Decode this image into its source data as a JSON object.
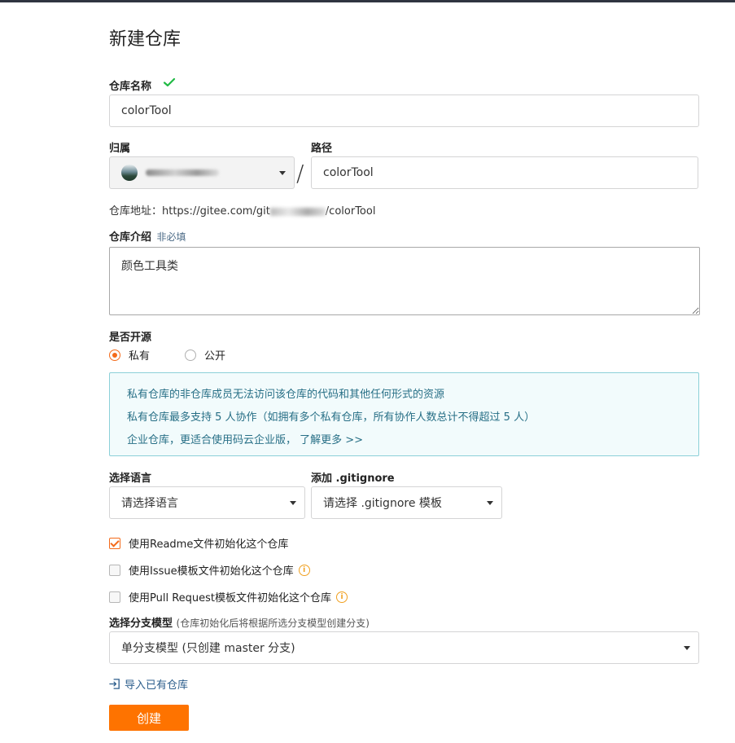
{
  "page": {
    "title": "新建仓库"
  },
  "repo_name": {
    "label": "仓库名称",
    "value": "colorTool"
  },
  "owner": {
    "label": "归属"
  },
  "path": {
    "label": "路径",
    "separator": "/",
    "value": "colorTool"
  },
  "address": {
    "prefix": "仓库地址：https://gitee.com/git",
    "suffix": "/colorTool"
  },
  "description": {
    "label": "仓库介绍",
    "optional_tag": "非必填",
    "value": "颜色工具类"
  },
  "visibility": {
    "label": "是否开源",
    "options": [
      {
        "label": "私有",
        "selected": true
      },
      {
        "label": "公开",
        "selected": false
      }
    ]
  },
  "notice": {
    "lines": [
      "私有仓库的非仓库成员无法访问该仓库的代码和其他任何形式的资源",
      "私有仓库最多支持 5 人协作（如拥有多个私有仓库，所有协作人数总计不得超过 5 人）"
    ],
    "line3_text": "企业仓库，更适合使用码云企业版，",
    "line3_link": "了解更多 >>"
  },
  "language": {
    "label": "选择语言",
    "selected": "请选择语言"
  },
  "gitignore": {
    "label": "添加 .gitignore",
    "selected": "请选择 .gitignore 模板"
  },
  "init_options": [
    {
      "label": "使用Readme文件初始化这个仓库",
      "checked": true
    },
    {
      "label": "使用Issue模板文件初始化这个仓库",
      "checked": false
    },
    {
      "label": "使用Pull Request模板文件初始化这个仓库",
      "checked": false
    }
  ],
  "branch_model": {
    "label": "选择分支模型",
    "hint": "(仓库初始化后将根据所选分支模型创建分支)",
    "selected": "单分支模型 (只创建 master 分支)"
  },
  "import_link": "导入已有仓库",
  "create_button": "创建",
  "colors": {
    "accent": "#fe7300",
    "success": "#21ba45",
    "notice_border": "#8cd0d8",
    "notice_bg": "#f2fbfc",
    "link": "#2c5e8c"
  }
}
